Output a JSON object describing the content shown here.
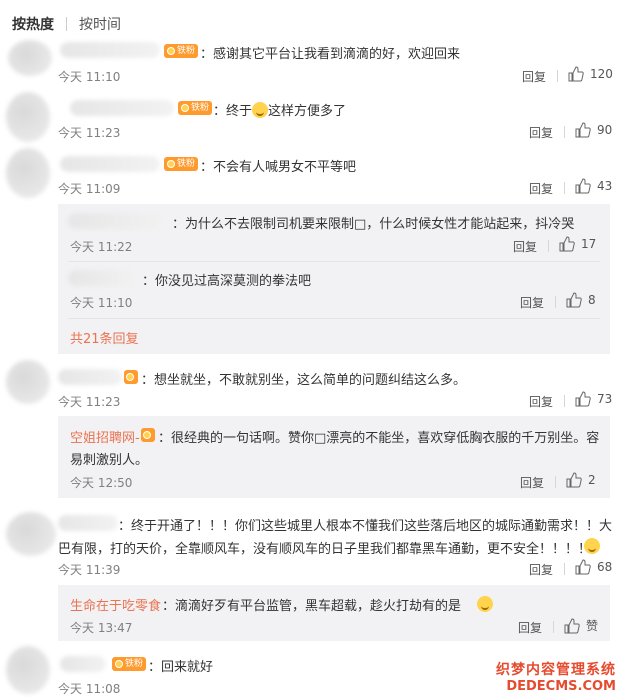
{
  "tabs": {
    "hot": "按热度",
    "time": "按时间"
  },
  "badge_label": "铁粉",
  "reply_label": "回复",
  "comments": [
    {
      "text": "：感谢其它平台让我看到滴滴的好，欢迎回来",
      "time": "今天 11:10",
      "likes": "120"
    },
    {
      "text_a": "：终于",
      "text_b": "这样方便多了",
      "time": "今天 11:23",
      "likes": "90"
    },
    {
      "text": "：不会有人喊男女不平等吧",
      "time": "今天 11:09",
      "likes": "43"
    },
    {
      "text": "：想坐就坐，不敢就别坐，这么简单的问题纠结这么多。",
      "time": "今天 11:23",
      "likes": "73"
    },
    {
      "line1": "：终于开通了！！！你们这些城里人根本不懂我们这些落后地区的城际通勤需求！！大",
      "line2": "巴有限，打的天价，全靠顺风车，没有顺风车的日子里我们都靠黑车通勤，更不安全！！！！",
      "time": "今天 11:39",
      "likes": "68"
    },
    {
      "text": "：回来就好",
      "time": "今天 11:08",
      "likes": ""
    }
  ],
  "replies_c3": [
    {
      "text": "：为什么不去限制司机要来限制□，什么时候女性才能站起来，抖冷哭",
      "time": "今天 11:22",
      "likes": "17"
    },
    {
      "text": "：你没见过高深莫测的拳法吧",
      "time": "今天 11:10",
      "likes": "8"
    }
  ],
  "more_replies": "共21条回复",
  "reply_c4": {
    "name": "空姐招聘网-",
    "line1": "：很经典的一句话啊。赞你□漂亮的不能坐，喜欢穿低胸衣服的千万别坐。容",
    "line2": "易刺激别人。",
    "time": "今天 12:50",
    "likes": "2"
  },
  "reply_c5": {
    "name": "生命在于吃零食",
    "text": "：滴滴好歹有平台监管，黑车超载，趁火打劫有的是",
    "time": "今天 13:47",
    "like_label": "赞"
  },
  "watermark": {
    "line1": "织梦内容管理系统",
    "line2": "DEDECMS.COM"
  }
}
